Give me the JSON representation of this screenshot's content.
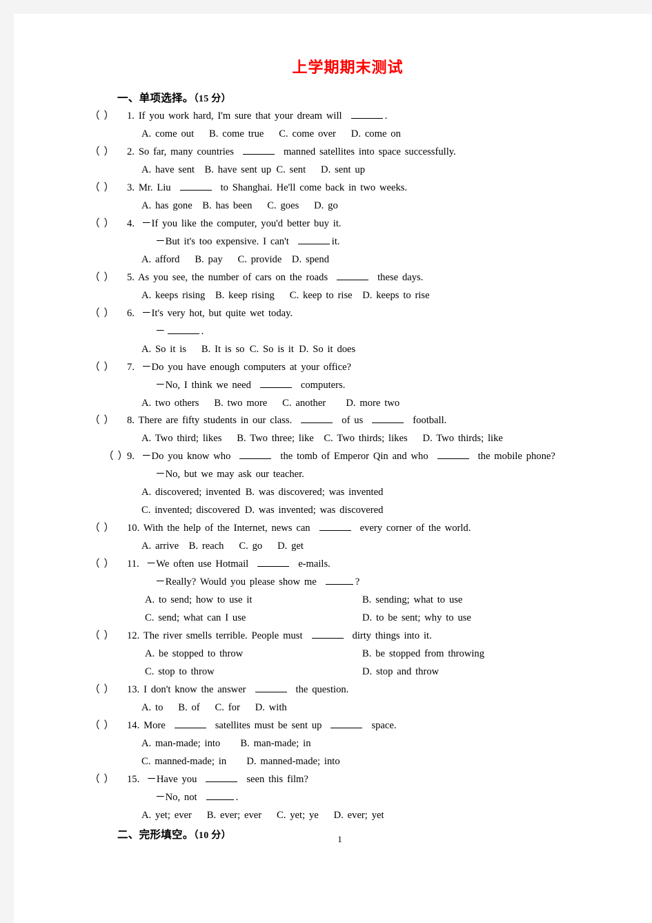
{
  "document": {
    "title": "上学期期末测试",
    "title_color": "#ff0000",
    "page_number": "1"
  },
  "sections": [
    {
      "heading": "一、单项选择。",
      "points": "（15 分）"
    },
    {
      "heading": "二、完形填空。",
      "points": "（10 分）"
    }
  ],
  "questions": [
    {
      "num": "1.",
      "stem_a": "If you work hard, I'm sure that your dream will",
      "stem_b": ".",
      "options_line": "A. come out  B. come true  C. come over  D. come on"
    },
    {
      "num": "2.",
      "stem_a": "So far, many countries",
      "stem_b": "manned satellites into space successfully.",
      "options_line": "A. have sent B. have sent up C. sent  D. sent up"
    },
    {
      "num": "3.",
      "stem_a": "Mr. Liu",
      "stem_b": "to Shanghai. He'll come back in two weeks.",
      "options_line": "A. has gone B. has been  C. goes  D. go"
    },
    {
      "num": "4.",
      "stem_a": "－If you like the computer, you'd better buy it.",
      "cont_a": "－But it's too expensive. I can't",
      "cont_b": "it.",
      "options_line": "A. afford  B. pay  C. provide D. spend"
    },
    {
      "num": "5.",
      "stem_a": "As you see, the number of cars on the roads",
      "stem_b": "these days.",
      "options_line": "A. keeps rising B. keep rising  C. keep to rise D. keeps to rise"
    },
    {
      "num": "6.",
      "stem_a": "－It's very hot, but quite wet today.",
      "cont_dash": "－",
      "cont_b": ".",
      "options_line": "A. So it is  B. It is so C. So is it D. So it does"
    },
    {
      "num": "7.",
      "stem_a": "－Do you have enough computers at your office?",
      "cont_a": "－No, I think we need",
      "cont_b": "computers.",
      "options_line": "A. two others  B. two more  C. another  D. more two"
    },
    {
      "num": "8.",
      "stem_a": "There are fifty students in our class.",
      "stem_mid": "of us",
      "stem_b": "football.",
      "options_line": "A. Two third; likes  B. Two three; like C. Two thirds; likes  D. Two thirds; like"
    },
    {
      "num": "9.",
      "stem_a": "－Do you know who",
      "stem_mid": "the tomb of Emperor Qin and who",
      "stem_b": "the mobile phone?",
      "cont_a": "－No, but we may ask our teacher.",
      "options_line_1": "A. discovered; invented B. was discovered; was invented",
      "options_line_2": "C. invented; discovered D. was invented; was discovered"
    },
    {
      "num": "10.",
      "stem_a": "With the help of the Internet, news can",
      "stem_b": "every corner of the world.",
      "options_line": "A. arrive B. reach  C. go  D. get"
    },
    {
      "num": "11.",
      "stem_a": "－We often use Hotmail",
      "stem_b": "e-mails.",
      "cont_a": "－Really? Would you please show me",
      "cont_b": "?",
      "opt_A": "A. to send; how to use it",
      "opt_B": "B. sending; what to use",
      "opt_C": "C. send; what can I use",
      "opt_D": "D. to be sent; why to use"
    },
    {
      "num": "12.",
      "stem_a": "The river smells terrible. People must",
      "stem_b": "dirty things into it.",
      "opt_A": "A. be stopped to throw",
      "opt_B": "B. be stopped from throwing",
      "opt_C": "C. stop to throw",
      "opt_D": "D. stop and throw"
    },
    {
      "num": "13.",
      "stem_a": "I don't know the answer",
      "stem_b": "the question.",
      "options_line": "A. to  B. of  C. for  D. with"
    },
    {
      "num": "14.",
      "stem_a": "More",
      "stem_mid": "satellites must be sent up",
      "stem_b": "space.",
      "options_line_1": "A. man-made; into  B. man-made; in",
      "options_line_2": "C. manned-made; in  D. manned-made; into"
    },
    {
      "num": "15.",
      "stem_a": "－Have you",
      "stem_b": "seen this film?",
      "cont_a": "－No, not",
      "cont_b": ".",
      "options_line": "A. yet; ever  B. ever; ever  C. yet; ye  D. ever; yet"
    }
  ]
}
